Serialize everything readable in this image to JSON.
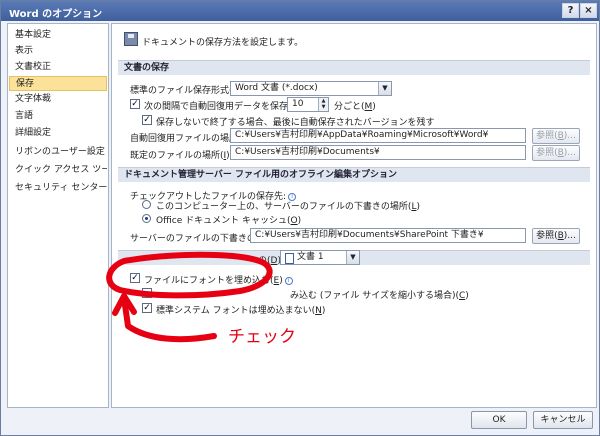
{
  "window": {
    "title": "Word のオプション",
    "help_label": "?",
    "close_label": "×"
  },
  "sidebar": {
    "items": [
      {
        "label": "基本設定"
      },
      {
        "label": "表示"
      },
      {
        "label": "文書校正"
      },
      {
        "label": "保存",
        "selected": true
      },
      {
        "label": "文字体裁"
      },
      {
        "label": "言語"
      },
      {
        "label": "詳細設定"
      },
      {
        "label": "リボンのユーザー設定"
      },
      {
        "label": "クイック アクセス ツール バー"
      },
      {
        "label": "セキュリティ センター"
      }
    ]
  },
  "main": {
    "intro": "ドキュメントの保存方法を設定します。",
    "save_section": {
      "header": "文書の保存",
      "format_label": "標準のファイル保存形式(",
      "format_key": "F",
      "format_value": "Word 文書 (*.docx)",
      "autorecover_label": "次の間隔で自動回復用データを保存する(",
      "autorecover_key": "A",
      "autorecover_value": "10",
      "minutes_label": "分ごと(",
      "minutes_key": "M",
      "keep_last_label": "保存しないで終了する場合、最後に自動保存されたバージョンを残す",
      "recover_location_label": "自動回復用ファイルの場所(",
      "recover_location_key": "R",
      "recover_location_value": "C:¥Users¥吉村印刷¥AppData¥Roaming¥Microsoft¥Word¥",
      "browse_label": "参照(",
      "browse_key": "B",
      "default_location_label": "既定のファイルの場所(",
      "default_location_key": "I",
      "default_location_value": "C:¥Users¥吉村印刷¥Documents¥"
    },
    "server_section": {
      "header": "ドキュメント管理サーバー ファイル用のオフライン編集オプション",
      "checkout_label": "チェックアウトしたファイルの保存先:",
      "option_server_label": "このコンピューター上の、サーバーのファイルの下書きの場所(",
      "option_server_key": "L",
      "option_cache_label": "Office ドキュメント キャッシュ(",
      "option_cache_key": "O",
      "drafts_label": "サーバーのファイルの下書きの場所(",
      "drafts_key": "V",
      "drafts_value": "C:¥Users¥吉村印刷¥Documents¥SharePoint 下書き¥",
      "browse_label": "参照(",
      "browse_key": "B"
    },
    "fidelity_section": {
      "header_fragment": "の",
      "header_key": "D",
      "doc_value": "文書 1",
      "embed_label": "ファイルにフォントを埋め込む(",
      "embed_key": "E",
      "embed_used_tail": "み込む (ファイル サイズを縮小する場合)(",
      "embed_used_key": "C",
      "no_system_label": "標準システム フォントは埋め込まない(",
      "no_system_key": "N"
    }
  },
  "footer": {
    "ok_label": "OK",
    "cancel_label": "キャンセル"
  },
  "annotation": {
    "text": "チェック",
    "color": "#e60012"
  }
}
